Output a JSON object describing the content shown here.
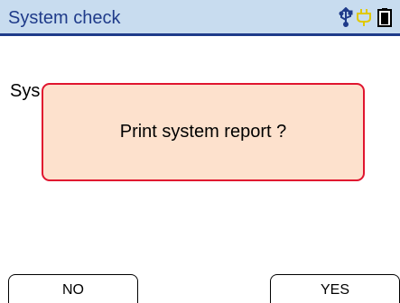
{
  "header": {
    "title": "System check",
    "icons": [
      "usb-icon",
      "plug-icon",
      "battery-icon"
    ]
  },
  "background": {
    "text": "Sys"
  },
  "dialog": {
    "message": "Print system report ?"
  },
  "softkeys": {
    "left_label": "NO",
    "right_label": "YES"
  },
  "colors": {
    "title_bar_bg": "#c8dcef",
    "title_text": "#1f3b8a",
    "dialog_bg": "#fde1cd",
    "dialog_border": "#e0152f",
    "usb_icon": "#1f3b8a",
    "plug_icon": "#e0c800"
  }
}
